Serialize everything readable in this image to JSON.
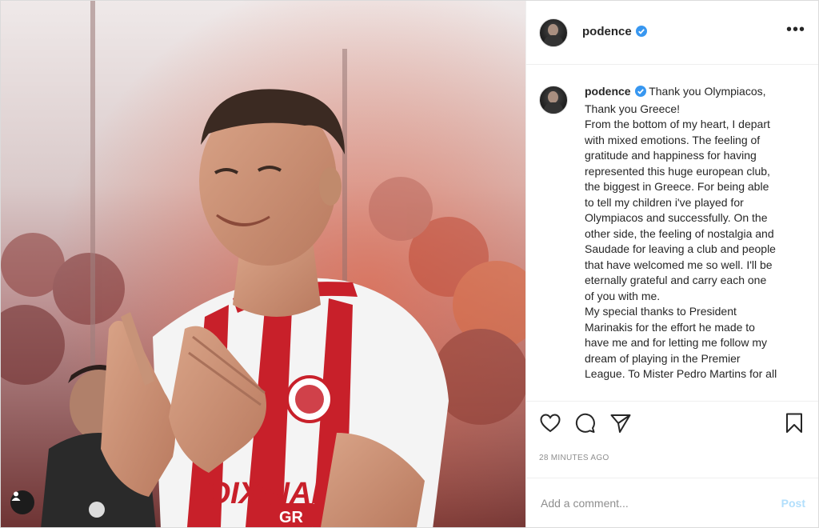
{
  "profile": {
    "username": "podence",
    "verified": true
  },
  "header": {
    "more_icon": "more-horizontal-icon",
    "more_label": "•••"
  },
  "caption": {
    "username": "podence",
    "text": " Thank you Olympiacos,\nThank you Greece!\nFrom the bottom of my heart, I depart\nwith mixed emotions. The feeling of\ngratitude and happiness for having\nrepresented this huge european club,\nthe biggest in Greece. For being able\nto tell my children i've played for\nOlympiacos and successfully. On the\nother side, the feeling of nostalgia and\nSaudade for leaving a club and people\nthat have welcomed me so well. I'll be\neternally grateful and carry each one\nof you with me.\nMy special thanks to President\nMarinakis for the effort he made to\nhave me and for letting me follow my\ndream of playing in the Premier\nLeague. To Mister Pedro Martins for all"
  },
  "photo": {
    "shirt_sponsor": "TOIXINAP",
    "shirt_sponsor_sub": "GR",
    "tag_icon": "user-tag-icon"
  },
  "actions": {
    "like_icon": "heart-icon",
    "comment_icon": "comment-icon",
    "share_icon": "paper-plane-icon",
    "save_icon": "bookmark-icon"
  },
  "timestamp": "28 MINUTES AGO",
  "comment": {
    "placeholder": "Add a comment...",
    "value": "",
    "post_label": "Post"
  },
  "colors": {
    "accent": "#0095f6",
    "post_disabled": "#b2dffc",
    "verified_badge": "#3897f0",
    "border": "#dbdbdb"
  }
}
